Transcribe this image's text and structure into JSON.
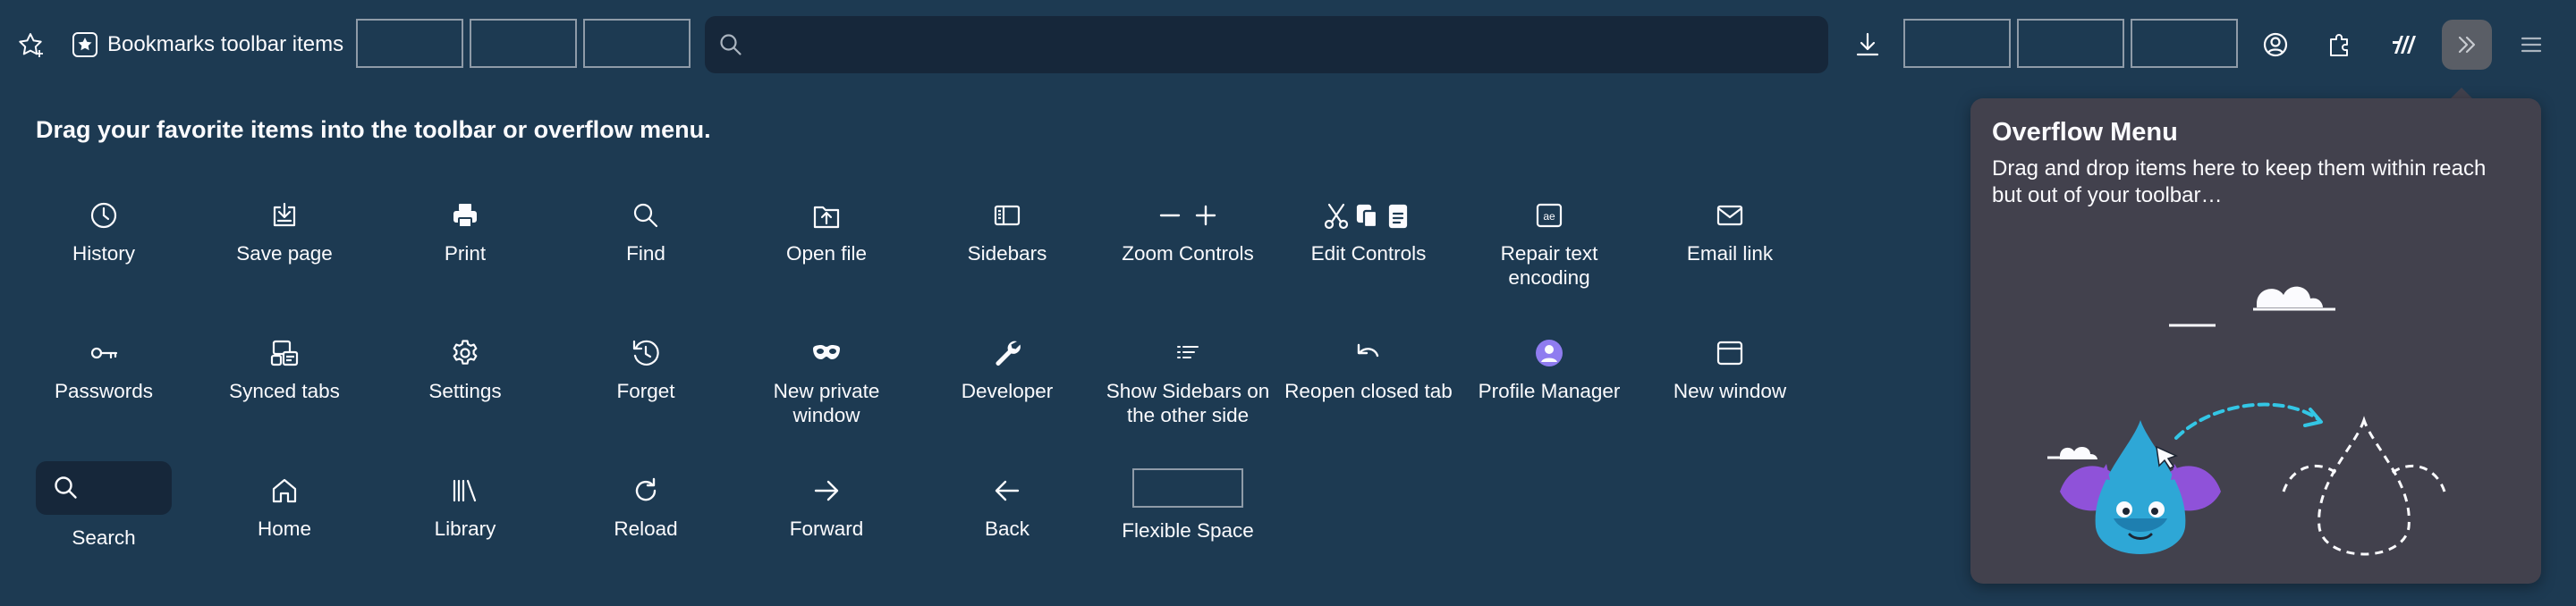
{
  "toolbar": {
    "bookmarks_label": "Bookmarks toolbar items",
    "search_placeholder": ""
  },
  "heading": "Drag your favorite items into the toolbar or overflow menu.",
  "palette": {
    "rows": [
      [
        {
          "label": "History",
          "icon": "history-icon"
        },
        {
          "label": "Save page",
          "icon": "save-page-icon"
        },
        {
          "label": "Print",
          "icon": "print-icon"
        },
        {
          "label": "Find",
          "icon": "find-icon"
        },
        {
          "label": "Open file",
          "icon": "open-file-icon"
        },
        {
          "label": "Sidebars",
          "icon": "sidebars-icon"
        },
        {
          "label": "Zoom Controls",
          "icon": "zoom-controls-icon"
        },
        {
          "label": "Edit Controls",
          "icon": "edit-controls-icon"
        },
        {
          "label": "Repair text encoding",
          "icon": "text-encoding-icon"
        },
        {
          "label": "Email link",
          "icon": "email-icon"
        }
      ],
      [
        {
          "label": "Passwords",
          "icon": "key-icon"
        },
        {
          "label": "Synced tabs",
          "icon": "synced-tabs-icon"
        },
        {
          "label": "Settings",
          "icon": "gear-icon"
        },
        {
          "label": "Forget",
          "icon": "forget-icon"
        },
        {
          "label": "New private window",
          "icon": "private-window-icon"
        },
        {
          "label": "Developer",
          "icon": "wrench-icon"
        },
        {
          "label": "Show Sidebars on the other side",
          "icon": "sidebar-position-icon"
        },
        {
          "label": "Reopen closed tab",
          "icon": "undo-icon"
        },
        {
          "label": "Profile Manager",
          "icon": "profile-icon"
        },
        {
          "label": "New window",
          "icon": "new-window-icon"
        }
      ],
      [
        {
          "label": "Search",
          "icon": "search-icon"
        },
        {
          "label": "Home",
          "icon": "home-icon"
        },
        {
          "label": "Library",
          "icon": "library-icon"
        },
        {
          "label": "Reload",
          "icon": "reload-icon"
        },
        {
          "label": "Forward",
          "icon": "forward-arrow-icon"
        },
        {
          "label": "Back",
          "icon": "back-arrow-icon"
        },
        {
          "label": "Flexible Space",
          "icon": "flexible-space"
        }
      ]
    ]
  },
  "overflow_panel": {
    "title": "Overflow Menu",
    "description": "Drag and drop items here to keep them within reach but out of your toolbar…"
  },
  "colors": {
    "background": "#1d3a52",
    "panel": "#42414d",
    "urlbar": "#16273a",
    "accent": "#8f7cf0"
  }
}
